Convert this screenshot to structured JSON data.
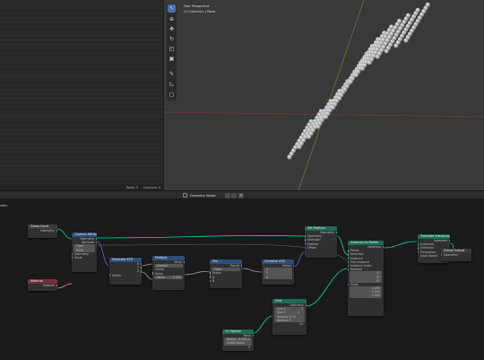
{
  "viewport": {
    "perspective_label": "User Perspective",
    "collection_label": "(1) Collection | Plane"
  },
  "left_status": {
    "rows": "Rows: 0",
    "columns": "Columns: 0"
  },
  "toolbar": {
    "tools": [
      {
        "name": "select-tool-icon",
        "glyph": "↖"
      },
      {
        "name": "cursor-tool-icon",
        "glyph": "⊕"
      },
      {
        "name": "move-tool-icon",
        "glyph": "✥"
      },
      {
        "name": "rotate-tool-icon",
        "glyph": "↻"
      },
      {
        "name": "scale-tool-icon",
        "glyph": "◰"
      },
      {
        "name": "transform-tool-icon",
        "glyph": "▣"
      },
      {
        "name": "annotate-tool-icon",
        "glyph": "✎"
      },
      {
        "name": "measure-tool-icon",
        "glyph": "◺"
      },
      {
        "name": "add-cube-tool-icon",
        "glyph": "▢"
      }
    ]
  },
  "node_editor": {
    "title": "Geometry Nodes",
    "side_label": "odes"
  },
  "nodes": {
    "group_input": {
      "title": "Group Input",
      "out": "Geometry"
    },
    "material": {
      "title": "Material",
      "out": "Material"
    },
    "capture": {
      "title": "Capture Attribute",
      "out1": "Geometry",
      "out2": "Attribute",
      "in1": "Geometry",
      "in2": "Float",
      "in3": "Point",
      "in4": "Geometry",
      "in5": "Value"
    },
    "separate": {
      "title": "Separate XYZ",
      "out1": "X",
      "out2": "Y",
      "out3": "Z",
      "in1": "Vector"
    },
    "multiply": {
      "title": "Multiply",
      "out": "Value",
      "op": "Multiply",
      "in1": "Clamp",
      "in2": "Value",
      "in3": "Value",
      "val": "2.000"
    },
    "mix": {
      "title": "Mix",
      "out": "Result",
      "in1": "Float",
      "in2": "Factor",
      "in3": "A",
      "in4": "B"
    },
    "combine": {
      "title": "Combine XYZ",
      "out": "Vector",
      "in1": "X",
      "in2": "Y",
      "in3": "Z"
    },
    "set_position": {
      "title": "Set Position",
      "out": "Geometry",
      "in1": "Geometry",
      "in2": "Selection",
      "in3": "Position",
      "in4": "Offset"
    },
    "instance": {
      "title": "Instance on Points",
      "out": "Instances",
      "in1": "Points",
      "in2": "Selection",
      "in3": "Instance",
      "in4": "Pick Instance",
      "in5": "Instance Index",
      "in6": "Rotation",
      "in7": "Scale",
      "rot": [
        "0°",
        "0°",
        "0°"
      ],
      "scale": [
        "1.000",
        "1.000",
        "1.000"
      ]
    },
    "realize": {
      "title": "Translate Instances",
      "out": "Instances",
      "in1": "Instances",
      "in2": "Selection",
      "in3": "Translation",
      "in4": "Local Space"
    },
    "group_output": {
      "title": "Group Output",
      "in1": "Geometry"
    },
    "ico": {
      "title": "Ico Sphere",
      "out": "Mesh",
      "in1": "Radius",
      "v1": "0.100",
      "in2": "Subdivisions",
      "v2": "1"
    },
    "uv_sphere": {
      "title": "Grid",
      "out": "Geometry",
      "in1": "Size X",
      "in2": "Size Y",
      "in3": "Vertices X",
      "in4": "Vertices Y",
      "v1": "1",
      "v2": "1",
      "v3": "10",
      "v4": "10"
    },
    "radius": {
      "title": "UV Sphere",
      "out": "Mesh",
      "in1": "Radius",
      "in2": "Subdivisions",
      "v1": "0.050 m",
      "v2": "5"
    }
  }
}
